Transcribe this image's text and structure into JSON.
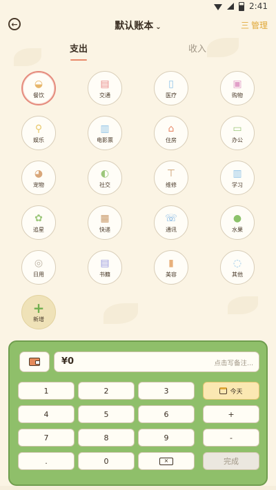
{
  "status": {
    "time": "2:41"
  },
  "header": {
    "title": "默认账本",
    "title_chevron": "⌄",
    "manage_label": "管理",
    "manage_icon": "三"
  },
  "tabs": [
    {
      "label": "支出",
      "active": true
    },
    {
      "label": "收入",
      "active": false
    }
  ],
  "categories": [
    {
      "label": "餐饮",
      "icon": "bowl-icon",
      "selected": true
    },
    {
      "label": "交通",
      "icon": "bus-icon"
    },
    {
      "label": "医疗",
      "icon": "medicine-icon"
    },
    {
      "label": "购物",
      "icon": "shopping-bag-icon"
    },
    {
      "label": "娱乐",
      "icon": "magnifier-icon"
    },
    {
      "label": "电影票",
      "icon": "ticket-icon"
    },
    {
      "label": "住房",
      "icon": "house-icon"
    },
    {
      "label": "办公",
      "icon": "monitor-icon"
    },
    {
      "label": "宠物",
      "icon": "cat-icon"
    },
    {
      "label": "社交",
      "icon": "chat-people-icon"
    },
    {
      "label": "维修",
      "icon": "hammer-icon"
    },
    {
      "label": "学习",
      "icon": "book-icon"
    },
    {
      "label": "追星",
      "icon": "star-tree-icon"
    },
    {
      "label": "快递",
      "icon": "box-icon"
    },
    {
      "label": "通讯",
      "icon": "phone-icon"
    },
    {
      "label": "水果",
      "icon": "apple-icon"
    },
    {
      "label": "日用",
      "icon": "tissue-roll-icon"
    },
    {
      "label": "书籍",
      "icon": "books-icon"
    },
    {
      "label": "美容",
      "icon": "cosmetics-icon"
    },
    {
      "label": "其他",
      "icon": "speech-bubble-icon"
    },
    {
      "label": "新增",
      "icon": "plus-icon",
      "add": true
    }
  ],
  "keypad": {
    "amount": "¥0",
    "note_placeholder": "点击写备注...",
    "keys": [
      [
        "1",
        "2",
        "3",
        "今天"
      ],
      [
        "4",
        "5",
        "6",
        "+"
      ],
      [
        "7",
        "8",
        "9",
        "-"
      ],
      [
        ".",
        "0",
        "⌫",
        "完成"
      ]
    ]
  },
  "colors": {
    "accent": "#e0a838",
    "keypad_green": "#8fbf6a",
    "selected_ring": "#e58a7c",
    "background": "#fbf4e4"
  }
}
